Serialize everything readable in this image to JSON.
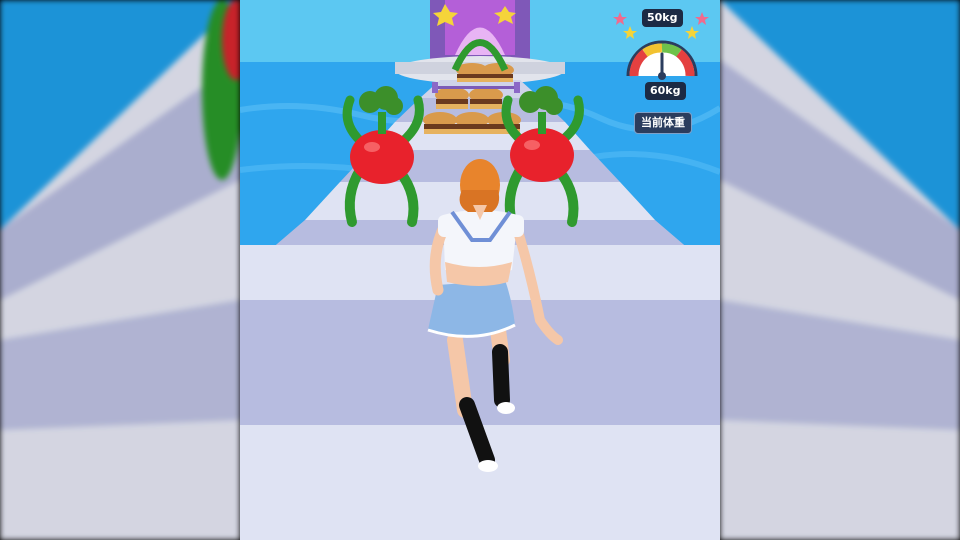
{
  "hud": {
    "target_weight": "50kg",
    "current_weight": "60kg",
    "current_weight_label": "当前体重",
    "gauge_level_fraction": 0.5
  },
  "scene": {
    "sky_color": "#5cc8f2",
    "water_color": "#2fa6ee",
    "track_light": "#dfe3f3",
    "track_dark": "#b7bce0",
    "tomato_color": "#e8222c",
    "stem_color": "#2f9a2f",
    "skirt_color": "#8db7e6",
    "hair_color": "#e8842c"
  }
}
